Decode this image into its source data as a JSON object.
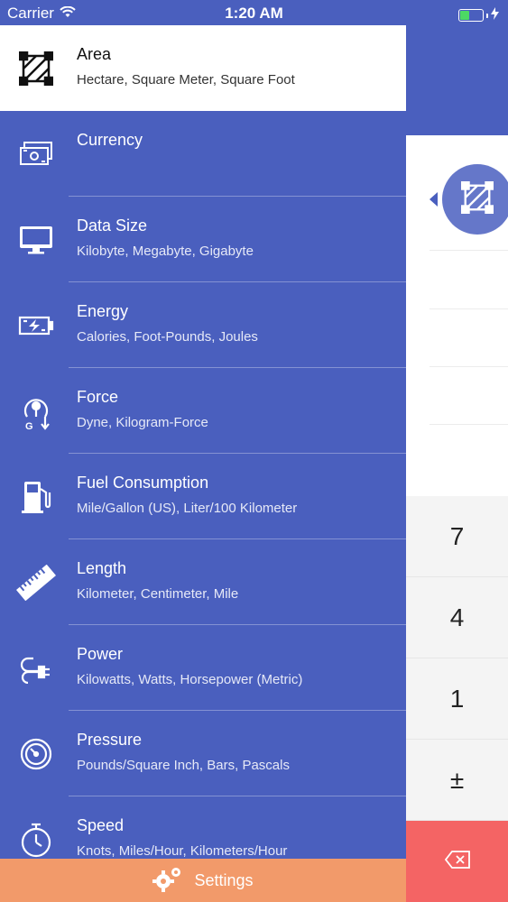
{
  "status_bar": {
    "carrier": "Carrier",
    "time": "1:20 AM",
    "battery_color": "#4cd964"
  },
  "menu": {
    "items": [
      {
        "title": "Area",
        "subtitle": "Hectare, Square Meter, Square Foot",
        "icon": "area-icon",
        "active": true
      },
      {
        "title": "Currency",
        "subtitle": "",
        "icon": "currency-icon"
      },
      {
        "title": "Data Size",
        "subtitle": "Kilobyte, Megabyte, Gigabyte",
        "icon": "monitor-icon"
      },
      {
        "title": "Energy",
        "subtitle": "Calories, Foot-Pounds, Joules",
        "icon": "battery-charge-icon"
      },
      {
        "title": "Force",
        "subtitle": "Dyne, Kilogram-Force",
        "icon": "force-icon"
      },
      {
        "title": "Fuel Consumption",
        "subtitle": "Mile/Gallon (US), Liter/100 Kilometer",
        "icon": "fuel-pump-icon"
      },
      {
        "title": "Length",
        "subtitle": "Kilometer, Centimeter, Mile",
        "icon": "ruler-icon"
      },
      {
        "title": "Power",
        "subtitle": "Kilowatts, Watts, Horsepower (Metric)",
        "icon": "plug-icon"
      },
      {
        "title": "Pressure",
        "subtitle": "Pounds/Square Inch, Bars, Pascals",
        "icon": "gauge-icon"
      },
      {
        "title": "Speed",
        "subtitle": "Knots, Miles/Hour, Kilometers/Hour",
        "icon": "stopwatch-icon"
      }
    ]
  },
  "settings": {
    "label": "Settings",
    "icon": "gears-icon"
  },
  "keypad": {
    "keys": [
      "7",
      "4",
      "1",
      "±"
    ],
    "delete_icon": "backspace-icon"
  },
  "colors": {
    "primary": "#4a5fbe",
    "settings_bar": "#f29a6a",
    "delete_key": "#f46464"
  }
}
